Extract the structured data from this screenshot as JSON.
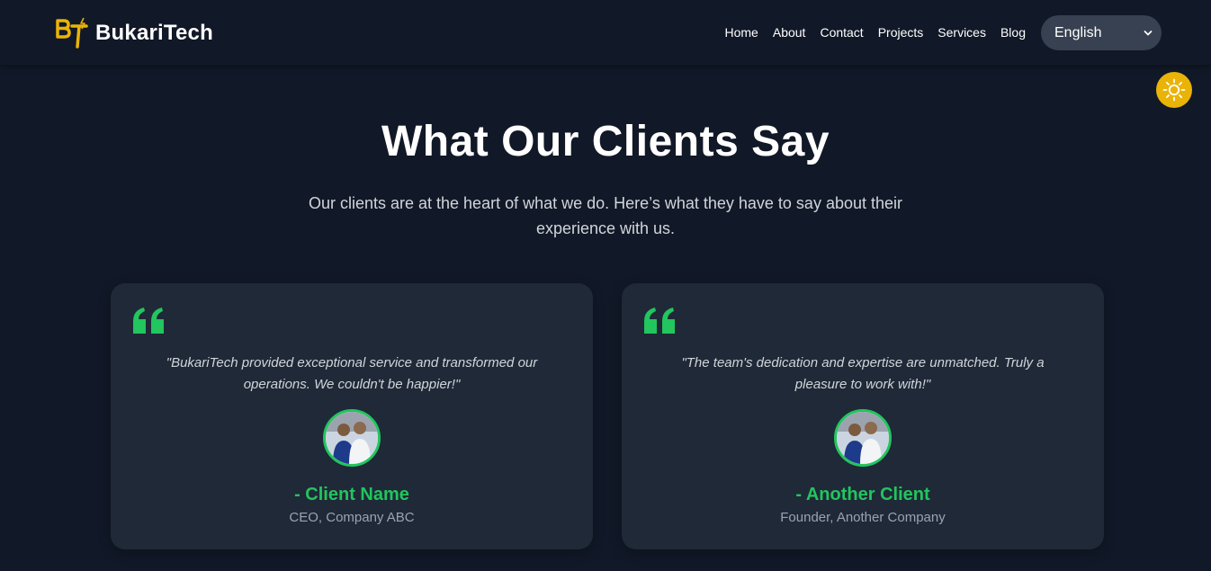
{
  "brand": {
    "logo_mark": "BT",
    "name": "BukariTech"
  },
  "nav": {
    "links": [
      "Home",
      "About",
      "Contact",
      "Projects",
      "Services",
      "Blog"
    ],
    "language": {
      "selected": "English"
    }
  },
  "theme_toggle": {
    "icon": "sun-icon"
  },
  "testimonials": {
    "title": "What Our Clients Say",
    "subtitle": "Our clients are at the heart of what we do. Here’s what they have to say about their experience with us.",
    "items": [
      {
        "quote": "\"BukariTech provided exceptional service and transformed our operations. We couldn't be happier!\"",
        "name": "- Client Name",
        "role": "CEO, Company ABC"
      },
      {
        "quote": "\"The team's dedication and expertise are unmatched. Truly a pleasure to work with!\"",
        "name": "- Another Client",
        "role": "Founder, Another Company"
      }
    ]
  },
  "colors": {
    "background": "#111827",
    "card": "#1f2937",
    "accent_green": "#22c55e",
    "accent_yellow": "#eab308",
    "select_bg": "#374151"
  }
}
